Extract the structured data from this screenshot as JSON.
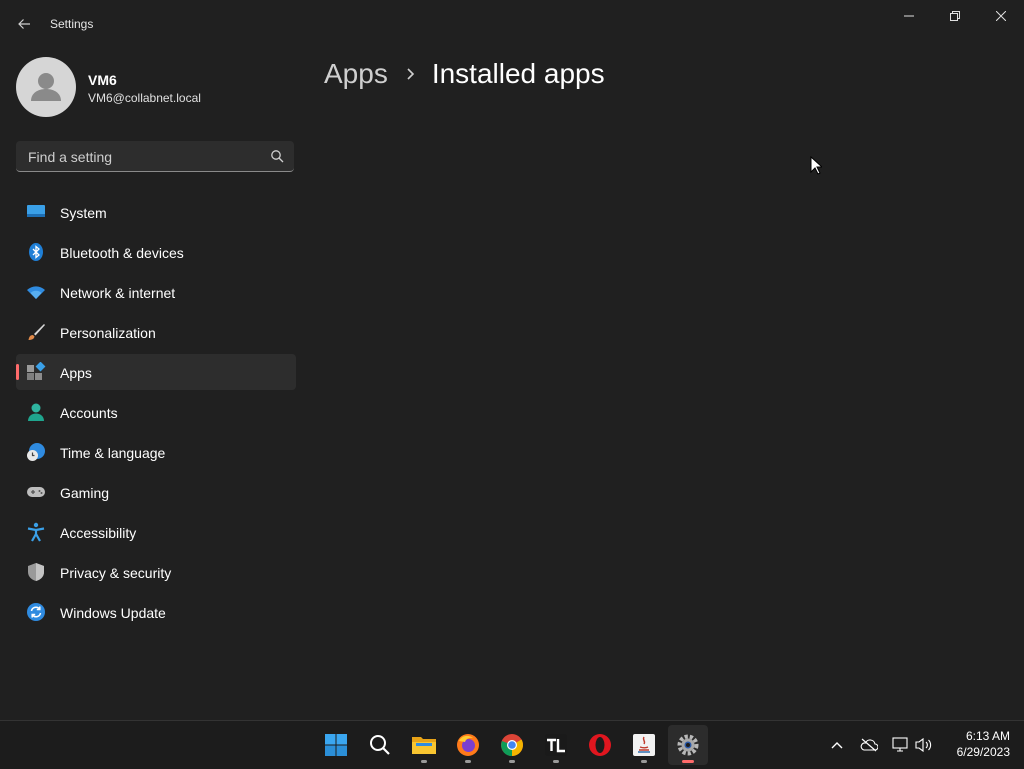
{
  "window": {
    "title": "Settings",
    "back_icon": "back-arrow-icon",
    "controls": [
      "minimize-icon",
      "maximize-icon",
      "close-icon"
    ]
  },
  "profile": {
    "name": "VM6",
    "email": "VM6@collabnet.local"
  },
  "search": {
    "placeholder": "Find a setting",
    "value": ""
  },
  "nav": {
    "items": [
      {
        "label": "System",
        "icon": "system-icon"
      },
      {
        "label": "Bluetooth & devices",
        "icon": "bluetooth-icon"
      },
      {
        "label": "Network & internet",
        "icon": "wifi-icon"
      },
      {
        "label": "Personalization",
        "icon": "brush-icon"
      },
      {
        "label": "Apps",
        "icon": "apps-icon",
        "selected": true
      },
      {
        "label": "Accounts",
        "icon": "person-icon"
      },
      {
        "label": "Time & language",
        "icon": "clock-globe-icon"
      },
      {
        "label": "Gaming",
        "icon": "gamepad-icon"
      },
      {
        "label": "Accessibility",
        "icon": "accessibility-icon"
      },
      {
        "label": "Privacy & security",
        "icon": "shield-icon"
      },
      {
        "label": "Windows Update",
        "icon": "update-icon"
      }
    ]
  },
  "breadcrumb": {
    "parent": "Apps",
    "current": "Installed apps"
  },
  "taskbar": {
    "apps": [
      "windows-start-icon",
      "search-icon",
      "file-explorer-icon",
      "firefox-icon",
      "chrome-icon",
      "tl-app-icon",
      "opera-icon",
      "java-app-icon",
      "settings-gear-icon"
    ],
    "tray": [
      "chevron-up-icon",
      "onedrive-offline-icon",
      "network-icon",
      "volume-icon"
    ],
    "time": "6:13 AM",
    "date": "6/29/2023"
  },
  "colors": {
    "background": "#202020",
    "accent": "#ff6b6b",
    "selected": "#2d2d2d"
  }
}
